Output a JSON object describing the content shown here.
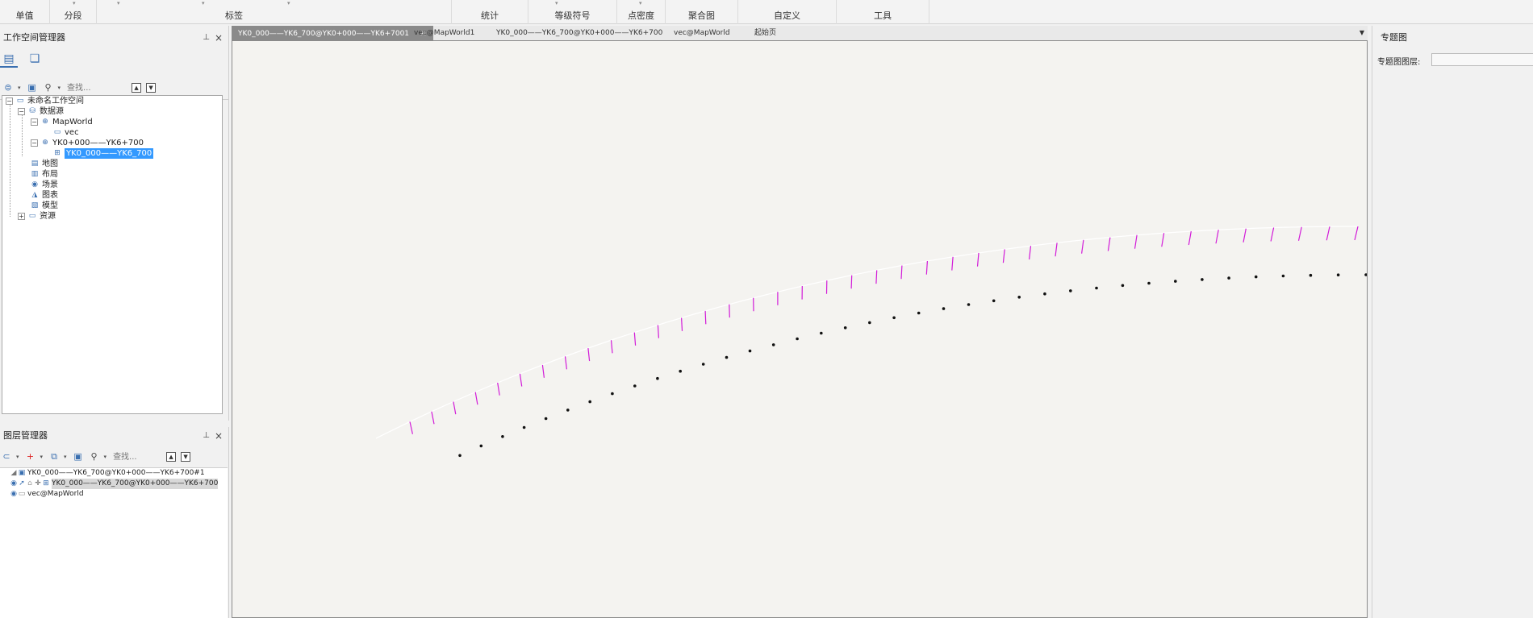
{
  "ribbon": {
    "groups": [
      "单值",
      "分段",
      "标签",
      "统计",
      "等级符号",
      "点密度",
      "聚合图",
      "自定义",
      "工具"
    ]
  },
  "workspace": {
    "title": "工作空间管理器",
    "pin": "ᵽ",
    "close": "×",
    "search_placeholder": "查找...",
    "tree": {
      "root": "未命名工作空间",
      "datasources": "数据源",
      "ds1": "MapWorld",
      "ds1_child": "vec",
      "ds2": "YK0+000——YK6+700",
      "ds2_child": "YK0_000——YK6_700",
      "maps": "地图",
      "layouts": "布局",
      "scenes": "场景",
      "charts": "图表",
      "models": "模型",
      "resources": "资源"
    }
  },
  "layers": {
    "title": "图层管理器",
    "pin": "ᵽ",
    "close": "×",
    "search_placeholder": "查找...",
    "items": [
      "YK0_000——YK6_700@YK0+000——YK6+700#1",
      "YK0_000——YK6_700@YK0+000——YK6+700",
      "vec@MapWorld"
    ]
  },
  "tabs": {
    "items": [
      "YK0_000——YK6_700@YK0+000——YK6+7001",
      "vec@MapWorld1",
      "YK0_000——YK6_700@YK0+000——YK6+700",
      "vec@MapWorld",
      "起始页"
    ],
    "close": "×"
  },
  "thematic": {
    "title": "专题图",
    "layer_label": "专题图图层:"
  },
  "colors": {
    "tick": "#d21bd8",
    "point": "#111111",
    "accent": "#3a6fb0"
  }
}
